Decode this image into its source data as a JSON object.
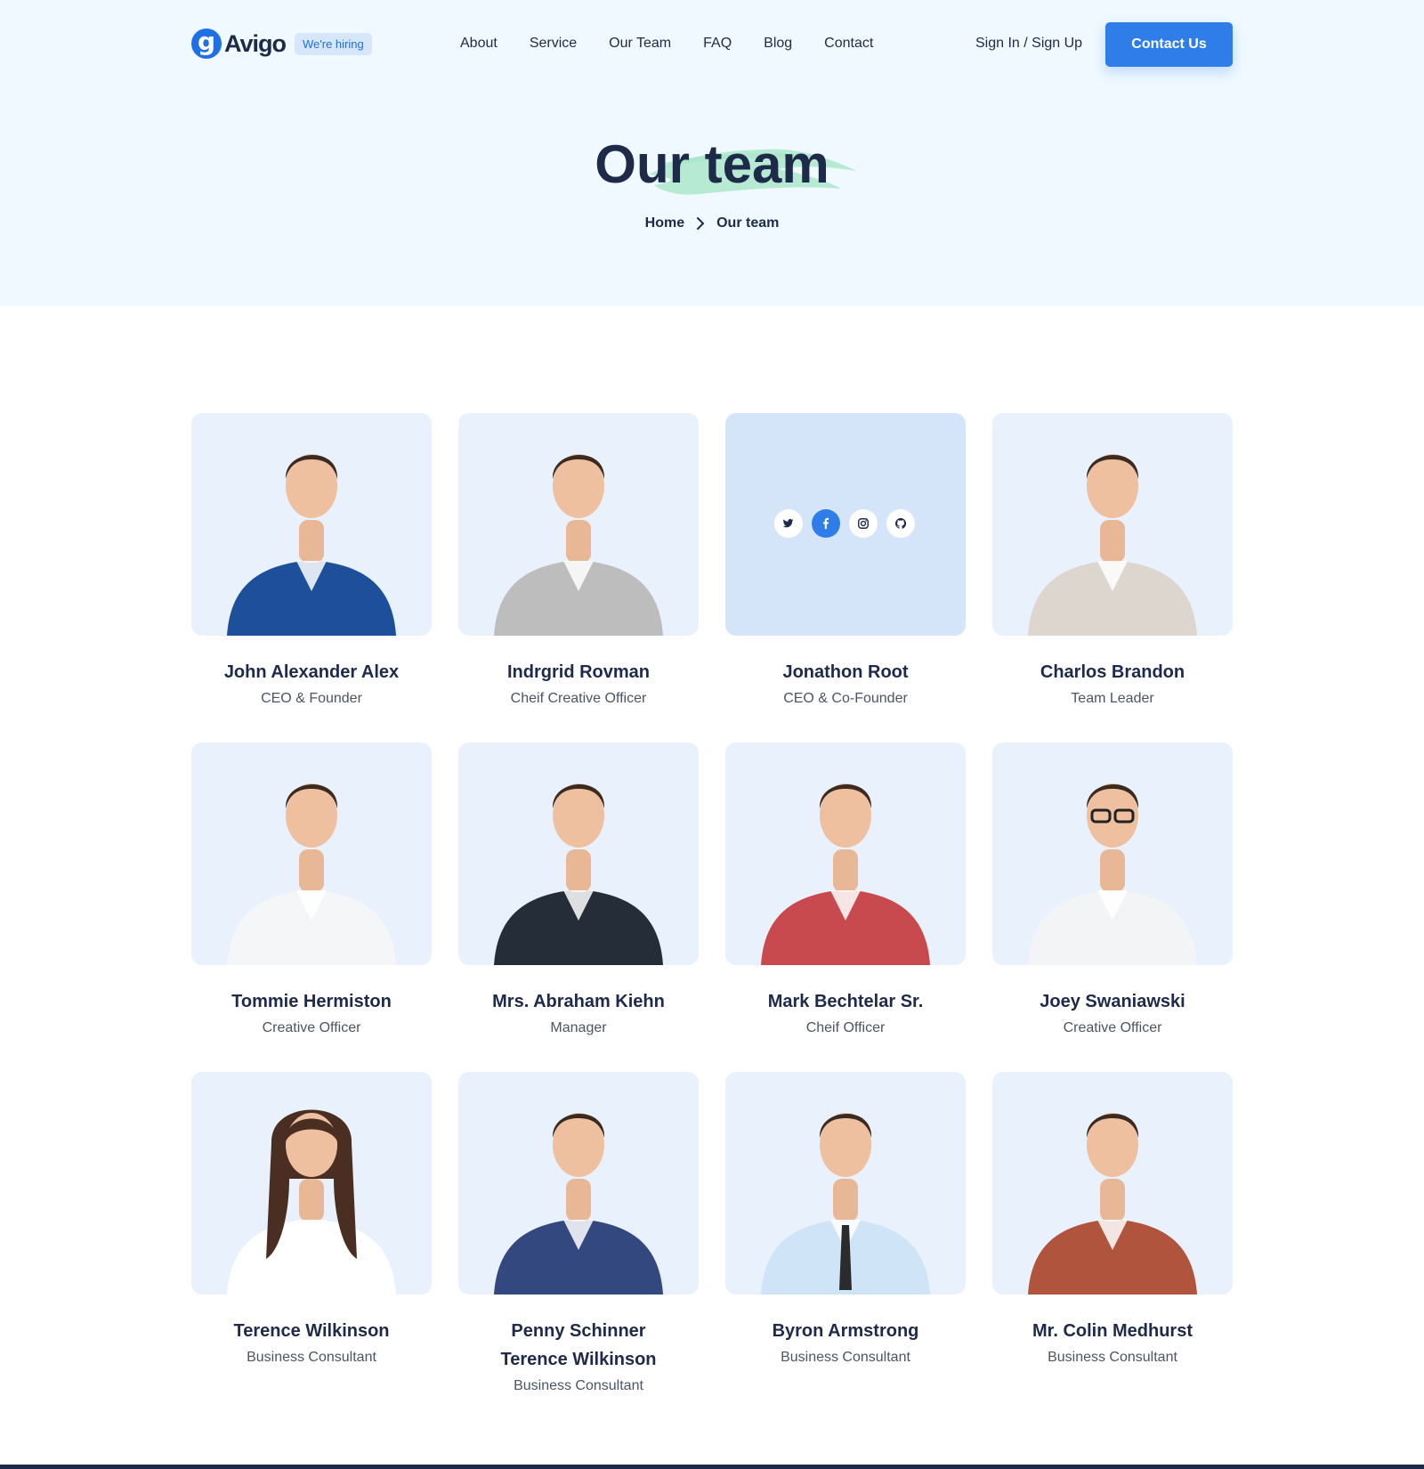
{
  "brand": {
    "name": "Avigo",
    "logo_glyph": "g",
    "hiring_badge": "We're hiring",
    "accent": "#2f7de9"
  },
  "nav": {
    "items": [
      {
        "label": "About"
      },
      {
        "label": "Service"
      },
      {
        "label": "Our Team"
      },
      {
        "label": "FAQ"
      },
      {
        "label": "Blog"
      },
      {
        "label": "Contact"
      }
    ],
    "signin_label": "Sign In / Sign Up",
    "cta_label": "Contact Us"
  },
  "hero": {
    "title": "Our team",
    "breadcrumb": {
      "home": "Home",
      "current": "Our team"
    }
  },
  "team": [
    {
      "name": "John Alexander Alex",
      "role": "CEO & Founder",
      "photo": "portrait-man-blue-jacket",
      "shirt": "#1d4f9a"
    },
    {
      "name": "Indrgrid Rovman",
      "role": "Cheif Creative Officer",
      "photo": "portrait-man-grey-blazer",
      "shirt": "#bdbdbd"
    },
    {
      "name": "Jonathon Root",
      "role": "CEO & Co-Founder",
      "photo": "social-links-hover",
      "socials": [
        "twitter-icon",
        "facebook-icon",
        "instagram-icon",
        "github-icon"
      ]
    },
    {
      "name": "Charlos Brandon",
      "role": "Team Leader",
      "photo": "portrait-man-beige-shirt",
      "shirt": "#ddd6cf"
    },
    {
      "name": "Tommie Hermiston",
      "role": "Creative Officer",
      "photo": "portrait-man-white-shirt",
      "shirt": "#f4f6f8"
    },
    {
      "name": "Mrs. Abraham Kiehn",
      "role": "Manager",
      "photo": "portrait-man-black-tshirt",
      "shirt": "#252d38"
    },
    {
      "name": "Mark Bechtelar Sr.",
      "role": "Cheif Officer",
      "photo": "portrait-man-plaid-shirt",
      "shirt": "#c94a4e"
    },
    {
      "name": "Joey Swaniawski",
      "role": "Creative Officer",
      "photo": "portrait-man-glasses",
      "shirt": "#f3f4f6"
    },
    {
      "name": "Terence Wilkinson",
      "role": "Business Consultant",
      "photo": "portrait-woman-long-hair",
      "shirt": "#ffffff"
    },
    {
      "name": "Penny Schinner\nTerence Wilkinson",
      "role": "Business Consultant",
      "photo": "portrait-man-navy-suit",
      "shirt": "#33487f"
    },
    {
      "name": "Byron Armstrong",
      "role": "Business Consultant",
      "photo": "portrait-man-tie",
      "shirt": "#cfe5f7"
    },
    {
      "name": "Mr. Colin Medhurst",
      "role": "Business Consultant",
      "photo": "portrait-man-checked-shirt",
      "shirt": "#b0543d"
    }
  ]
}
